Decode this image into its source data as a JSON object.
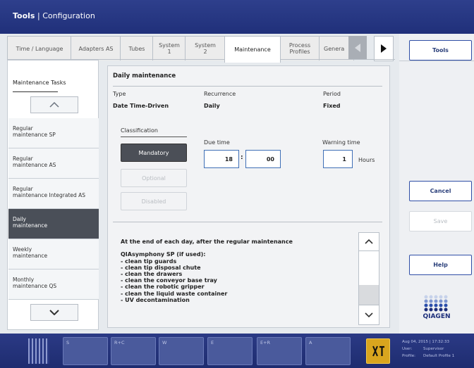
{
  "window": {
    "title_bold": "Tools",
    "title_sep": " | ",
    "title_rest": "Configuration"
  },
  "tabs": [
    {
      "label": "Time / Language"
    },
    {
      "label": "Adapters AS"
    },
    {
      "label": "Tubes"
    },
    {
      "label": "System\n1"
    },
    {
      "label": "System\n2"
    },
    {
      "label": "Maintenance",
      "active": true
    },
    {
      "label": "Process\nProfiles"
    },
    {
      "label": "Genera"
    }
  ],
  "left": {
    "header": "Maintenance Tasks",
    "items": [
      {
        "label": "Regular\nmaintenance SP"
      },
      {
        "label": "Regular\nmaintenance AS"
      },
      {
        "label": "Regular\nmaintenance Integrated AS"
      },
      {
        "label": "Daily\nmaintenance",
        "selected": true
      },
      {
        "label": "Weekly\nmaintenance"
      },
      {
        "label": "Monthly\nmaintenance QS"
      }
    ]
  },
  "main": {
    "title": "Daily maintenance",
    "type_label": "Type",
    "type_value": "Date Time-Driven",
    "recurrence_label": "Recurrence",
    "recurrence_value": "Daily",
    "period_label": "Period",
    "period_value": "Fixed",
    "classification_label": "Classification",
    "buttons": {
      "mandatory": "Mandatory",
      "optional": "Optional",
      "disabled": "Disabled"
    },
    "due_time_label": "Due time",
    "due_hour": "18",
    "due_sep": ":",
    "due_min": "00",
    "warning_label": "Warning time",
    "warning_value": "1",
    "warning_unit": "Hours",
    "description": "At the end of each day, after the regular maintenance\n\nQIAsymphony SP (if used):\n- clean tip guards\n- clean tip disposal chute\n- clean the drawers\n- clean the conveyor base tray\n- clean the robotic gripper\n- clean the liquid waste container\n- UV decontamination"
  },
  "right": {
    "tools": "Tools",
    "cancel": "Cancel",
    "save": "Save",
    "help": "Help",
    "logo": "QIAGEN"
  },
  "bottom": {
    "slots": [
      "S",
      "R+C",
      "W",
      "E",
      "E+R",
      "A"
    ],
    "status": {
      "date": "Aug 04, 2015 | 17:32:33",
      "user_label": "User:",
      "user": "Supervisor",
      "profile_label": "Profile:",
      "profile": "Default Profile 1"
    }
  },
  "colors": {
    "brand": "#20307a",
    "selected": "#4a4f58",
    "accent_border": "#2f4ea6"
  }
}
